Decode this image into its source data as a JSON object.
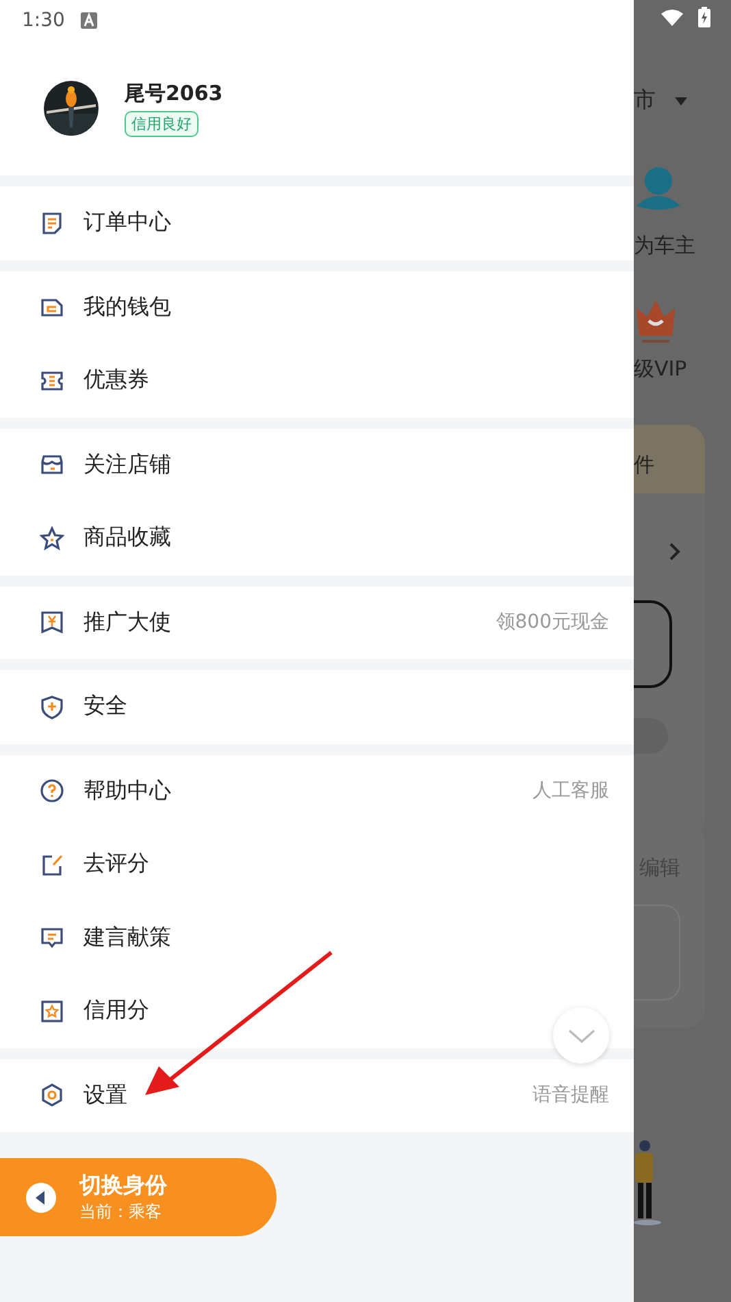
{
  "status_bar": {
    "time": "1:30"
  },
  "profile": {
    "name": "尾号2063",
    "badge": "信用良好"
  },
  "menu_groups": [
    {
      "items": [
        {
          "kind": "order",
          "label": "订单中心"
        }
      ]
    },
    {
      "items": [
        {
          "kind": "wallet",
          "label": "我的钱包"
        },
        {
          "kind": "coupon",
          "label": "优惠券"
        }
      ]
    },
    {
      "items": [
        {
          "kind": "shop",
          "label": "关注店铺"
        },
        {
          "kind": "star",
          "label": "商品收藏"
        }
      ]
    },
    {
      "items": [
        {
          "kind": "promo",
          "label": "推广大使",
          "note": "领800元现金"
        }
      ]
    },
    {
      "items": [
        {
          "kind": "shield",
          "label": "安全"
        }
      ]
    },
    {
      "items": [
        {
          "kind": "help",
          "label": "帮助中心",
          "note": "人工客服"
        },
        {
          "kind": "rate",
          "label": "去评分"
        },
        {
          "kind": "chat",
          "label": "建言献策"
        },
        {
          "kind": "credit",
          "label": "信用分"
        }
      ]
    },
    {
      "items": [
        {
          "kind": "settings",
          "label": "设置",
          "note": "语音提醒"
        }
      ]
    }
  ],
  "switch_identity": {
    "title": "切换身份",
    "subtitle": "当前：乘客"
  },
  "background_page": {
    "city": "市",
    "owner_label": "为车主",
    "vip_label": "级VIP",
    "card_label": "件",
    "edit_label": "编辑"
  }
}
